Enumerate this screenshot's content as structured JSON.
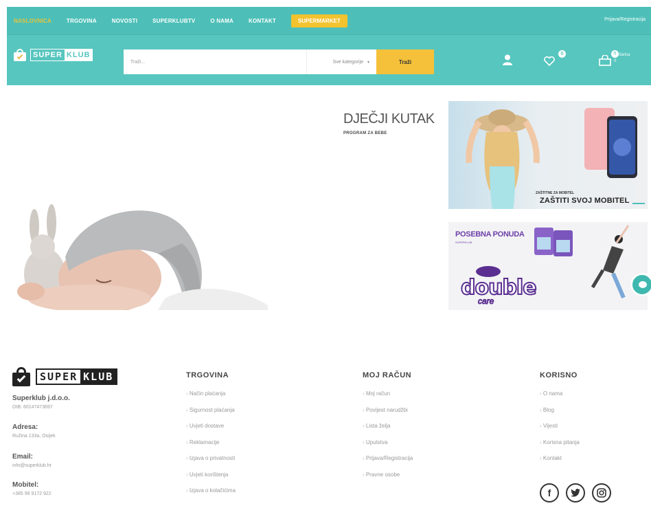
{
  "topnav": {
    "items": [
      "NASLOVNICA",
      "TRGOVINA",
      "NOVOSTI",
      "SUPERKLUBTV",
      "O NAMA",
      "KONTAKT"
    ],
    "highlight": "SUPERMARKET",
    "login": "Prijava/Registracija"
  },
  "header": {
    "logo": {
      "part1": "SUPER",
      "part2": "KLUB"
    },
    "search_placeholder": "Traži...",
    "category": "Sve kategorije",
    "search_button": "Traži",
    "wishlist_count": "0",
    "cart_count": "0",
    "cart_label": "Košarica",
    "cart_value": "0"
  },
  "hero": {
    "title": "DJEČJI KUTAK",
    "subtitle": "PROGRAM ZA BEBE"
  },
  "banner1": {
    "small": "ZAŠTITNE ZA MOBITEL",
    "big": "ZAŠTITI SVOJ MOBITEL"
  },
  "banner2": {
    "title": "POSEBNA PONUDA",
    "sub": "SUPERKLUB",
    "brand": "double",
    "brand2": "care"
  },
  "footer": {
    "logo": {
      "part1": "SUPER",
      "part2": "KLUB"
    },
    "company": "Superklub j.d.o.o.",
    "oib": "OIB: 60147473697",
    "address_label": "Adresa:",
    "address": "Ružina 133a, Osijek",
    "email_label": "Email:",
    "email": "info@superklub.hr",
    "mobile_label": "Mobitel:",
    "mobile": "+385 99 9172 922",
    "cols": [
      {
        "head": "TRGOVINA",
        "links": [
          "Način plaćanja",
          "Sigurnost plaćanja",
          "Uvjeti dostave",
          "Reklamacije",
          "Izjava o privatnosti",
          "Uvjeti korištenja",
          "Izjava o kolačićima"
        ]
      },
      {
        "head": "MOJ RAČUN",
        "links": [
          "Moj račun",
          "Povijest narudžbi",
          "Lista želja",
          "Uputstva",
          "Prijava/Registracija",
          "Pravne osobe"
        ]
      },
      {
        "head": "KORISNO",
        "links": [
          "O nama",
          "Blog",
          "Vijesti",
          "Korisna pitanja",
          "Kontakt"
        ]
      }
    ]
  },
  "colors": {
    "teal": "#57c6bf",
    "accent": "#f5c13a",
    "purple": "#5a2e91"
  }
}
